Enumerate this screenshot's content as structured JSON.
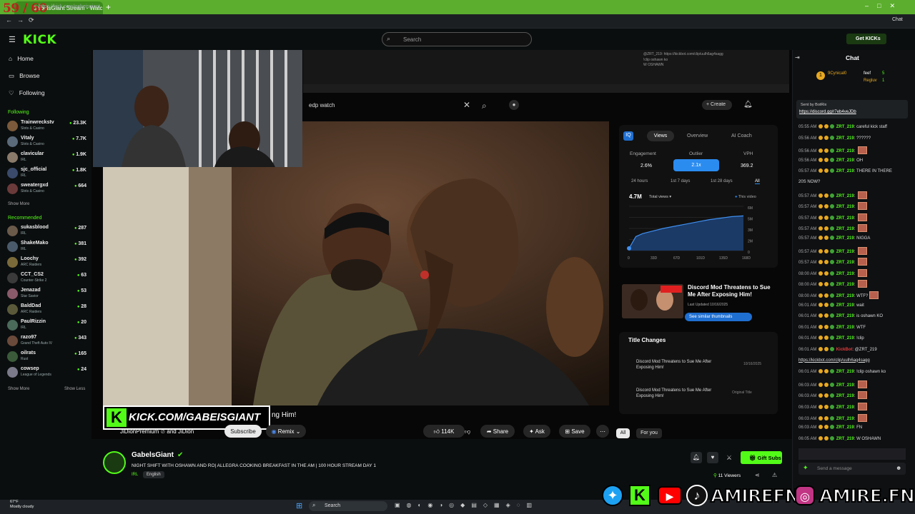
{
  "browser": {
    "tab_title": "GabelsGiant Stream - Watch",
    "url": "https://kick.com/gabeisgiant",
    "fps_overlay": "59 / 60",
    "profile_label": "Chat"
  },
  "kick": {
    "logo": "KICK",
    "search_placeholder": "Search",
    "get_kicks": "Get KICKs"
  },
  "sidebar": {
    "nav": [
      {
        "label": "Home",
        "icon": "home-icon"
      },
      {
        "label": "Browse",
        "icon": "browse-icon"
      },
      {
        "label": "Following",
        "icon": "heart-icon"
      }
    ],
    "following_title": "Following",
    "following": [
      {
        "name": "Trainwreckstv",
        "category": "Slots & Casino",
        "viewers": "23.3K",
        "color": "#7a5a3a"
      },
      {
        "name": "Vitaly",
        "category": "Slots & Casino",
        "viewers": "7.7K",
        "color": "#5a6a7a"
      },
      {
        "name": "clavicular",
        "category": "IRL",
        "viewers": "1.9K",
        "color": "#8a7a6a"
      },
      {
        "name": "sjc_official",
        "category": "IRL",
        "viewers": "1.8K",
        "color": "#3a4a6a"
      },
      {
        "name": "sweatergxd",
        "category": "Slots & Casino",
        "viewers": "664",
        "color": "#6a3a3a"
      }
    ],
    "show_more": "Show More",
    "recommended_title": "Recommended",
    "recommended": [
      {
        "name": "sukasblood",
        "category": "IRL",
        "viewers": "287",
        "color": "#6a5a4a"
      },
      {
        "name": "ShakeMako",
        "category": "IRL",
        "viewers": "381",
        "color": "#4a5a6a"
      },
      {
        "name": "Loochy",
        "category": "ARC Raiders",
        "viewers": "392",
        "color": "#7a6a3a"
      },
      {
        "name": "CCT_CS2",
        "category": "Counter-Strike 2",
        "viewers": "63",
        "color": "#3a3a3a"
      },
      {
        "name": "Jenazad",
        "category": "Star Savior",
        "viewers": "53",
        "color": "#8a5a6a"
      },
      {
        "name": "BaldDad",
        "category": "ARC Raiders",
        "viewers": "28",
        "color": "#5a5a3a"
      },
      {
        "name": "PaulRizzin",
        "category": "IRL",
        "viewers": "20",
        "color": "#4a6a5a"
      },
      {
        "name": "razo97",
        "category": "Grand Theft Auto IV",
        "viewers": "343",
        "color": "#6a4a3a"
      },
      {
        "name": "oilrats",
        "category": "Rust",
        "viewers": "165",
        "color": "#3a5a3a"
      },
      {
        "name": "cowsep",
        "category": "League of Legends",
        "viewers": "24",
        "color": "#7a7a8a"
      }
    ],
    "show_less": "Show Less"
  },
  "youtube": {
    "search_query": "edp watch",
    "create": "Create",
    "overlay_text": "KICK.COM/GABEISGIANT",
    "partial_title": "ng Him!",
    "channel": "JiDionPremium",
    "channel_suffix": "and JiDion",
    "subscribe": "Subscribe",
    "remix": "Remix",
    "likes": "114K",
    "share": "Share",
    "ask": "Ask",
    "save": "Save",
    "filter_all": "All",
    "filter_for_you": "For you"
  },
  "analytics": {
    "tabs": [
      "Views",
      "Overview",
      "AI Coach"
    ],
    "metrics": [
      {
        "label": "Engagement",
        "value": "2.6%"
      },
      {
        "label": "Outlier",
        "value": "2.1x"
      },
      {
        "label": "VPH",
        "value": "369.2"
      }
    ],
    "ranges": [
      "24 hours",
      "1st 7 days",
      "1st 28 days",
      "All"
    ],
    "total": "4.7M",
    "total_label": "Total views",
    "legend": "This video",
    "y_ticks": [
      "6M",
      "5M",
      "3M",
      "2M",
      "0"
    ],
    "x_ticks": [
      "0",
      "33D",
      "67D",
      "101D",
      "135D",
      "168D"
    ],
    "thumb_title": "Discord Mod Threatens to Sue Me After Exposing Him!",
    "thumb_date": "Last Updated 10/16/2025",
    "similar": "See similar thumbnails",
    "title_changes": "Title Changes",
    "changes": [
      {
        "title": "Discord Mod Threatens to Sue Me After Exposing Him!",
        "meta": "10/16/2025"
      },
      {
        "title": "Discord Mod Threatens to Sue Me After Exposing Him!",
        "meta": "Original Title"
      }
    ]
  },
  "chart_data": {
    "type": "area",
    "x": [
      0,
      10,
      20,
      33,
      50,
      67,
      84,
      101,
      118,
      135,
      150,
      168
    ],
    "values": [
      0.3,
      1.9,
      2.3,
      2.6,
      3.0,
      3.3,
      3.6,
      3.9,
      4.2,
      4.4,
      4.6,
      4.7
    ],
    "xlabel": "",
    "ylabel": "",
    "ylim": [
      0,
      6
    ]
  },
  "stream": {
    "streamer": "GabelsGiant",
    "title": "NIGHT SHIFT WITH OSHAWN AND RO| ALLEGRA COOKING BREAKFAST IN THE AM | 100 HOUR STREAM DAY 1",
    "tags": [
      "IRL",
      "English"
    ],
    "gift_subs": "Gift Subs",
    "viewers": "11 Viewers"
  },
  "chat": {
    "title": "Chat",
    "pinned_user1": "9Cynical0",
    "pinned_user2": "feef",
    "pinned_user3": "Regluv",
    "pinned_count1": "5",
    "pinned_count2": "1",
    "sent_by": "Sent by BotRix",
    "link": "https://discord.gg/r7eb4veJDb",
    "messages": [
      {
        "t": "05:55 AM",
        "u": "ZRT_219",
        "m": "careful kick staff"
      },
      {
        "t": "05:56 AM",
        "u": "ZRT_219",
        "m": "??????"
      },
      {
        "t": "05:56 AM",
        "u": "ZRT_219",
        "m": "",
        "e": 1
      },
      {
        "t": "05:56 AM",
        "u": "ZRT_219",
        "m": "OH"
      },
      {
        "t": "05:57 AM",
        "u": "ZRT_219",
        "m": "THERE IN THERE"
      },
      {
        "t": "",
        "u": "",
        "m": "20S NOW?"
      },
      {
        "t": "05:57 AM",
        "u": "ZRT_219",
        "m": "",
        "e": 1
      },
      {
        "t": "05:57 AM",
        "u": "ZRT_219",
        "m": "",
        "e": 1
      },
      {
        "t": "05:57 AM",
        "u": "ZRT_219",
        "m": "",
        "e": 1
      },
      {
        "t": "05:57 AM",
        "u": "ZRT_219",
        "m": "",
        "e": 1
      },
      {
        "t": "05:57 AM",
        "u": "ZRT_219",
        "m": "NIGGA"
      },
      {
        "t": "05:57 AM",
        "u": "ZRT_219",
        "m": "",
        "e": 1
      },
      {
        "t": "05:57 AM",
        "u": "ZRT_219",
        "m": "",
        "e": 1
      },
      {
        "t": "08:00 AM",
        "u": "ZRT_219",
        "m": "",
        "e": 1
      },
      {
        "t": "08:00 AM",
        "u": "ZRT_219",
        "m": "",
        "e": 1
      },
      {
        "t": "08:00 AM",
        "u": "ZRT_219",
        "m": "WTF?",
        "e": 1
      },
      {
        "t": "06:01 AM",
        "u": "ZRT_219",
        "m": "wait"
      },
      {
        "t": "06:01 AM",
        "u": "ZRT_219",
        "m": "is oshawn KO"
      },
      {
        "t": "06:01 AM",
        "u": "ZRT_219",
        "m": "WTF"
      },
      {
        "t": "06:01 AM",
        "u": "ZRT_219",
        "m": "!clip"
      },
      {
        "t": "06:01 AM",
        "u": "KickBot",
        "m": "@ZRT_219"
      },
      {
        "t": "",
        "u": "",
        "m": "https://kickbot.com/clip/uulh6ag4sagg"
      },
      {
        "t": "06:01 AM",
        "u": "ZRT_219",
        "m": "!clip oshawn ko"
      },
      {
        "t": "06:03 AM",
        "u": "ZRT_219",
        "m": "",
        "e": 1
      },
      {
        "t": "06:03 AM",
        "u": "ZRT_219",
        "m": "",
        "e": 1
      },
      {
        "t": "06:03 AM",
        "u": "ZRT_219",
        "m": "",
        "e": 1
      },
      {
        "t": "06:03 AM",
        "u": "ZRT_219",
        "m": "",
        "e": 1
      },
      {
        "t": "06:03 AM",
        "u": "ZRT_219",
        "m": "FN"
      },
      {
        "t": "06:05 AM",
        "u": "ZRT_219",
        "m": "W OSHAWN"
      }
    ],
    "input_placeholder": "Send a message"
  },
  "mini_chat": {
    "line1": "@ZRT_219: https://kickbot.com/clip/uulh6ag4sagg",
    "line2": "!clip oshawn ko",
    "line3": "W OSHAWN"
  },
  "social": {
    "handle1": "AMIREFN",
    "handle2": "AMIRE.FN"
  },
  "taskbar": {
    "weather_temp": "67°F",
    "weather_desc": "Mostly cloudy",
    "search": "Search"
  }
}
